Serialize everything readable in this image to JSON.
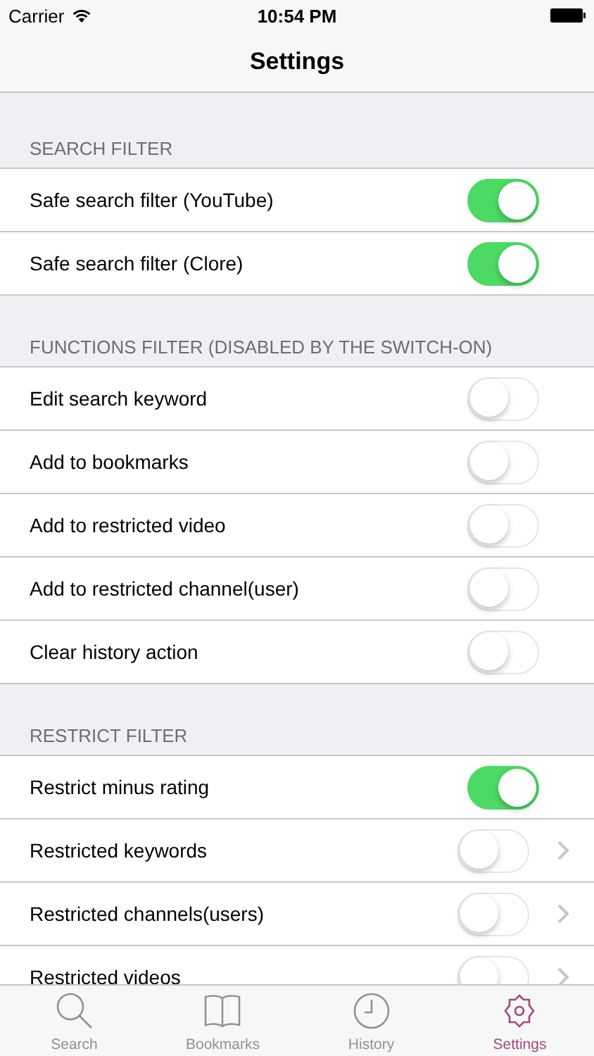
{
  "status_bar": {
    "carrier": "Carrier",
    "time": "10:54 PM"
  },
  "nav": {
    "title": "Settings"
  },
  "sections": [
    {
      "header": "SEARCH FILTER",
      "rows": [
        {
          "label": "Safe search filter (YouTube)",
          "on": true,
          "kind": "switch"
        },
        {
          "label": "Safe search filter (Clore)",
          "on": true,
          "kind": "switch"
        }
      ]
    },
    {
      "header": "FUNCTIONS FILTER (DISABLED BY THE SWITCH-ON)",
      "rows": [
        {
          "label": "Edit search keyword",
          "on": false,
          "kind": "switch"
        },
        {
          "label": "Add to bookmarks",
          "on": false,
          "kind": "switch"
        },
        {
          "label": "Add to restricted video",
          "on": false,
          "kind": "switch"
        },
        {
          "label": "Add to restricted channel(user)",
          "on": false,
          "kind": "switch"
        },
        {
          "label": "Clear history action",
          "on": false,
          "kind": "switch"
        }
      ]
    },
    {
      "header": "RESTRICT FILTER",
      "rows": [
        {
          "label": "Restrict minus rating",
          "on": true,
          "kind": "switch"
        },
        {
          "label": "Restricted keywords",
          "on": false,
          "kind": "switch_link"
        },
        {
          "label": "Restricted channels(users)",
          "on": false,
          "kind": "switch_link"
        },
        {
          "label": "Restricted videos",
          "on": false,
          "kind": "switch_link"
        }
      ]
    }
  ],
  "tabs": [
    {
      "label": "Search",
      "selected": false
    },
    {
      "label": "Bookmarks",
      "selected": false
    },
    {
      "label": "History",
      "selected": false
    },
    {
      "label": "Settings",
      "selected": true
    }
  ]
}
